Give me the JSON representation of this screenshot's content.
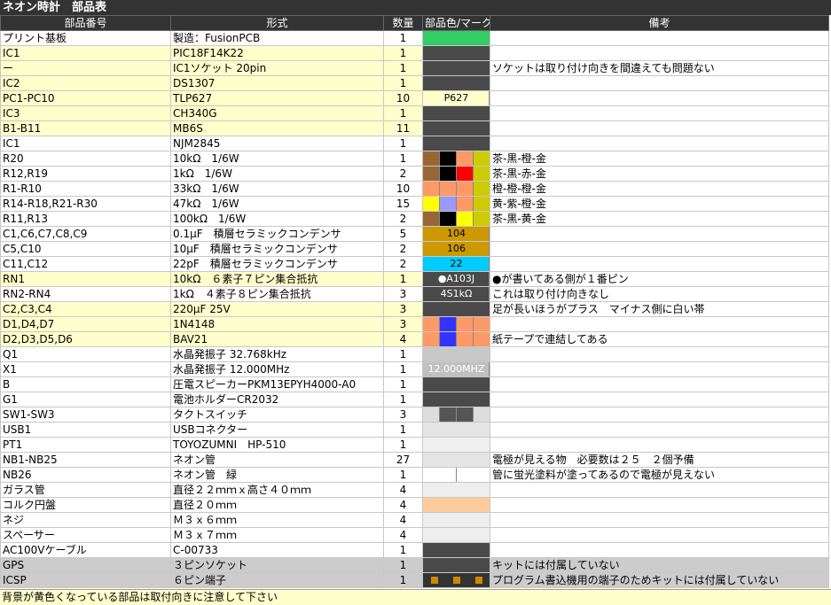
{
  "title": "ネオン時計　部品表",
  "headers": {
    "id": "部品番号",
    "type": "形式",
    "qty": "数量",
    "color": "部品色/マーク",
    "note": "備考"
  },
  "footnote": "背景が黄色くなっている部品は取付向きに注意して下さい",
  "colors": {
    "header_bg": "#333333",
    "orientation_yellow": "#ffffcc",
    "gray_row": "#cccccc"
  },
  "rows": [
    {
      "id": "プリント基板",
      "type": "製造：FusionPCB",
      "qty": "1",
      "note": "",
      "hl": "",
      "sw": [
        {
          "c": "#33cc66"
        }
      ]
    },
    {
      "id": "IC1",
      "type": "PIC18F14K22",
      "qty": "1",
      "note": "",
      "hl": "yellow",
      "sw": [
        {
          "c": "#4a4a4a"
        }
      ]
    },
    {
      "id": "ー",
      "type": "IC1ソケット 20pin",
      "qty": "1",
      "note": "ソケットは取り付け向きを間違えても問題ない",
      "hl": "yellow",
      "sw": [
        {
          "c": "#4a4a4a"
        }
      ]
    },
    {
      "id": "IC2",
      "type": "DS1307",
      "qty": "1",
      "note": "",
      "hl": "yellow",
      "sw": [
        {
          "c": "#4a4a4a"
        }
      ]
    },
    {
      "id": "PC1-PC10",
      "type": "TLP627",
      "qty": "10",
      "note": "",
      "hl": "yellow",
      "label": "P627",
      "labelColor": "#000000",
      "sw": [
        {
          "c": "#ffffcc"
        }
      ]
    },
    {
      "id": "IC3",
      "type": "CH340G",
      "qty": "1",
      "note": "",
      "hl": "yellow",
      "sw": [
        {
          "c": "#4a4a4a"
        }
      ]
    },
    {
      "id": "B1-B11",
      "type": "MB6S",
      "qty": "11",
      "note": "",
      "hl": "yellow",
      "sw": [
        {
          "c": "#4a4a4a"
        }
      ]
    },
    {
      "id": "IC1",
      "type": "NJM2845",
      "qty": "1",
      "note": "",
      "hl": "",
      "sw": [
        {
          "c": "#4a4a4a"
        }
      ]
    },
    {
      "id": "R20",
      "type": "10kΩ　1/6W",
      "qty": "1",
      "note": "茶-黒-橙-金",
      "hl": "",
      "sw": [
        {
          "c": "#996633"
        },
        {
          "c": "#000000"
        },
        {
          "c": "#ff9966"
        },
        {
          "c": "#cccc00"
        }
      ]
    },
    {
      "id": "R12,R19",
      "type": "1kΩ　1/6W",
      "qty": "2",
      "note": "茶-黒-赤-金",
      "hl": "",
      "sw": [
        {
          "c": "#996633"
        },
        {
          "c": "#000000"
        },
        {
          "c": "#ff0000"
        },
        {
          "c": "#cccc00"
        }
      ]
    },
    {
      "id": "R1-R10",
      "type": "33kΩ　1/6W",
      "qty": "10",
      "note": "橙-橙-橙-金",
      "hl": "",
      "sw": [
        {
          "c": "#ff9966"
        },
        {
          "c": "#ff9966"
        },
        {
          "c": "#ff9966"
        },
        {
          "c": "#cccc00"
        }
      ]
    },
    {
      "id": "R14-R18,R21-R30",
      "type": "47kΩ　1/6W",
      "qty": "15",
      "note": "黄-紫-橙-金",
      "hl": "",
      "sw": [
        {
          "c": "#ffff00"
        },
        {
          "c": "#9999ff"
        },
        {
          "c": "#ff9966"
        },
        {
          "c": "#cccc00"
        }
      ]
    },
    {
      "id": "R11,R13",
      "type": "100kΩ　1/6W",
      "qty": "2",
      "note": "茶-黒-黄-金",
      "hl": "",
      "sw": [
        {
          "c": "#996633"
        },
        {
          "c": "#000000"
        },
        {
          "c": "#ffff00"
        },
        {
          "c": "#cccc00"
        }
      ]
    },
    {
      "id": "C1,C6,C7,C8,C9",
      "type": "0.1μF　積層セラミックコンデンサ",
      "qty": "5",
      "note": "",
      "hl": "",
      "label": "104",
      "labelColor": "#000000",
      "sw": [
        {
          "c": "#cc9900"
        }
      ]
    },
    {
      "id": "C5,C10",
      "type": "10μF　積層セラミックコンデンサ",
      "qty": "2",
      "note": "",
      "hl": "",
      "label": "106",
      "labelColor": "#000000",
      "sw": [
        {
          "c": "#cc9900"
        }
      ]
    },
    {
      "id": "C11,C12",
      "type": "22pF　積層セラミックコンデンサ",
      "qty": "2",
      "note": "",
      "hl": "",
      "label": "22",
      "labelColor": "#000000",
      "sw": [
        {
          "c": "#00ccff"
        }
      ]
    },
    {
      "id": "RN1",
      "type": "10kΩ　６素子７ピン集合抵抗",
      "qty": "1",
      "note": "●が書いてある側が１番ピン",
      "hl": "yellow",
      "label": "●A103J",
      "labelColor": "#ffffff",
      "sw": [
        {
          "c": "#4a4a4a"
        }
      ]
    },
    {
      "id": "RN2-RN4",
      "type": "1kΩ　４素子８ピン集合抵抗",
      "qty": "3",
      "note": "これは取り付け向きなし",
      "hl": "",
      "label": "4S1kΩ",
      "labelColor": "#ffffff",
      "sw": [
        {
          "c": "#4a4a4a"
        }
      ]
    },
    {
      "id": "C2,C3,C4",
      "type": "220μF 25V",
      "qty": "3",
      "note": "足が長いほうがプラス　マイナス側に白い帯",
      "hl": "yellow",
      "sw": [
        {
          "c": "#4a4a4a"
        }
      ]
    },
    {
      "id": "D1,D4,D7",
      "type": "1N4148",
      "qty": "3",
      "note": "",
      "hl": "yellow",
      "sw": [
        {
          "c": "#ff9966"
        },
        {
          "c": "#3333ff"
        },
        {
          "c": "#ff9966"
        },
        {
          "c": "#ff9966"
        }
      ]
    },
    {
      "id": "D2,D3,D5,D6",
      "type": "BAV21",
      "qty": "4",
      "note": "紙テープで連結してある",
      "hl": "yellow",
      "sw": [
        {
          "c": "#ff9966"
        },
        {
          "c": "#3333ff"
        },
        {
          "c": "#ff9966"
        },
        {
          "c": "#ff9966"
        }
      ]
    },
    {
      "id": "Q1",
      "type": "水晶発振子 32.768kHz",
      "qty": "1",
      "note": "",
      "hl": "",
      "sw": [
        {
          "c": "#c8c8c8"
        }
      ]
    },
    {
      "id": "X1",
      "type": "水晶発振子 12.000MHz",
      "qty": "1",
      "note": "",
      "hl": "",
      "label": "12.000MHZ",
      "labelColor": "#ffffff",
      "sw": [
        {
          "c": "#c0c0c0"
        }
      ]
    },
    {
      "id": "B",
      "type": "圧電スピーカーPKM13EPYH4000-A0",
      "qty": "1",
      "note": "",
      "hl": "",
      "sw": [
        {
          "c": "#4a4a4a"
        }
      ]
    },
    {
      "id": "G1",
      "type": "電池ホルダーCR2032",
      "qty": "1",
      "note": "",
      "hl": "",
      "sw": [
        {
          "c": "#4a4a4a"
        }
      ]
    },
    {
      "id": "SW1-SW3",
      "type": "タクトスイッチ",
      "qty": "3",
      "note": "",
      "hl": "",
      "sw": [
        {
          "c": "#dddddd"
        },
        {
          "c": "#555555"
        },
        {
          "c": "#555555"
        },
        {
          "c": "#dddddd"
        }
      ]
    },
    {
      "id": "USB1",
      "type": "USBコネクター",
      "qty": "1",
      "note": "",
      "hl": "",
      "sw": [
        {
          "c": "#e4e4e4"
        }
      ]
    },
    {
      "id": "PT1",
      "type": "TOYOZUMNI　HP-510",
      "qty": "1",
      "note": "",
      "hl": "",
      "sw": [
        {
          "c": "#f0f0f0"
        }
      ]
    },
    {
      "id": "NB1-NB25",
      "type": "ネオン管",
      "qty": "27",
      "note": "電極が見える物　必要数は２５　２個予備",
      "hl": "",
      "sw": [
        {
          "c": "#e4e4e4"
        }
      ]
    },
    {
      "id": "NB26",
      "type": "ネオン管　緑",
      "qty": "1",
      "note": "管に蛍光塗料が塗ってあるので電極が見えない",
      "hl": "",
      "sw": [
        {
          "c": "#ffffff"
        },
        {
          "c": "#ffffff"
        }
      ]
    },
    {
      "id": "ガラス管",
      "type": "直径２２ｍｍｘ高さ４０ｍｍ",
      "qty": "4",
      "note": "",
      "hl": "",
      "sw": [
        {
          "c": "#eeeeee"
        }
      ]
    },
    {
      "id": "コルク円盤",
      "type": "直径２０ｍｍ",
      "qty": "4",
      "note": "",
      "hl": "",
      "sw": [
        {
          "c": "#ffcc99"
        }
      ]
    },
    {
      "id": "ネジ",
      "type": "Ｍ３ｘ６ｍｍ",
      "qty": "4",
      "note": "",
      "hl": "",
      "sw": [
        {
          "c": "#eeeeee"
        }
      ]
    },
    {
      "id": "スペーサー",
      "type": "Ｍ３ｘ７ｍｍ",
      "qty": "4",
      "note": "",
      "hl": "",
      "sw": [
        {
          "c": "#eeeeee"
        }
      ]
    },
    {
      "id": "AC100Vケーブル",
      "type": "C-00733",
      "qty": "1",
      "note": "",
      "hl": "",
      "sw": [
        {
          "c": "#4a4a4a"
        }
      ]
    },
    {
      "id": "GPS",
      "type": "３ピンソケット",
      "qty": "1",
      "note": "キットには付属していない",
      "hl": "gray",
      "sw": [
        {
          "c": "#4a4a4a"
        }
      ]
    },
    {
      "id": "ICSP",
      "type": "６ピン端子",
      "qty": "1",
      "note": "プログラム書込機用の端子のためキットには付属していない",
      "hl": "gray",
      "pins": 3,
      "sw": [
        {
          "c": "#333333"
        }
      ]
    }
  ]
}
